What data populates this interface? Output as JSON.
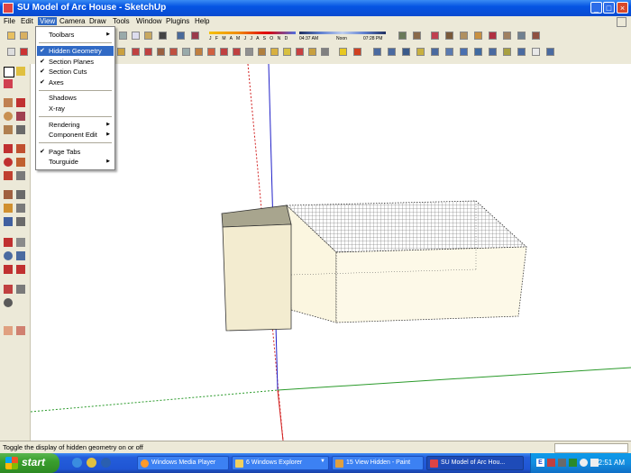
{
  "window": {
    "title": "SU Model of Arc House - SketchUp",
    "icon": "sketchup-app-icon",
    "controls": [
      "minimize-icon",
      "maximize-icon",
      "close-icon"
    ]
  },
  "menubar": {
    "items": [
      "File",
      "Edit",
      "View",
      "Camera",
      "Draw",
      "Tools",
      "Window",
      "Plugins",
      "Help"
    ],
    "active": "View"
  },
  "toolbar": {
    "shadow_settings": {
      "months": "J F M A M J J A S O N D",
      "time_start": "04:37 AM",
      "time_mid": "Noon",
      "time_end": "07:28 PM"
    }
  },
  "view_menu": {
    "items": [
      {
        "label": "Toolbars",
        "checked": false,
        "submenu": true,
        "highlighted": false
      },
      {
        "label": "Hidden Geometry",
        "checked": true,
        "submenu": false,
        "highlighted": true
      },
      {
        "label": "Section Planes",
        "checked": true,
        "submenu": false,
        "highlighted": false
      },
      {
        "label": "Section Cuts",
        "checked": true,
        "submenu": false,
        "highlighted": false
      },
      {
        "label": "Axes",
        "checked": true,
        "submenu": false,
        "highlighted": false
      },
      {
        "label": "Shadows",
        "checked": false,
        "submenu": false,
        "highlighted": false
      },
      {
        "label": "X-ray",
        "checked": false,
        "submenu": false,
        "highlighted": false
      },
      {
        "label": "Rendering",
        "checked": false,
        "submenu": true,
        "highlighted": false
      },
      {
        "label": "Component Edit",
        "checked": false,
        "submenu": true,
        "highlighted": false
      },
      {
        "label": "Page Tabs",
        "checked": true,
        "submenu": false,
        "highlighted": false
      },
      {
        "label": "Tourguide",
        "checked": false,
        "submenu": true,
        "highlighted": false
      }
    ],
    "check_glyph": "✔",
    "arrow_glyph": "▶"
  },
  "status_bar": {
    "message": "Toggle the display of hidden geometry on or off"
  },
  "taskbar": {
    "start_label": "start",
    "quick_launch": [
      "ie-icon",
      "outlook-icon",
      "media-player-icon"
    ],
    "tasks": [
      {
        "label": "Windows Media Player",
        "active": false
      },
      {
        "label": "6 Windows Explorer",
        "active": false
      },
      {
        "label": "15 View Hidden - Paint",
        "active": false
      },
      {
        "label": "SU Model of Arc Hou...",
        "active": true
      }
    ],
    "tray": {
      "clock": "2:51 AM",
      "lang": "E"
    }
  },
  "colors": {
    "axis_red": "#d22020",
    "axis_green": "#2a9a2a",
    "axis_blue": "#2020c8",
    "box_face": "#f3ecd0",
    "box_top": "#a8a58e",
    "menu_highlight": "#316ac5"
  }
}
